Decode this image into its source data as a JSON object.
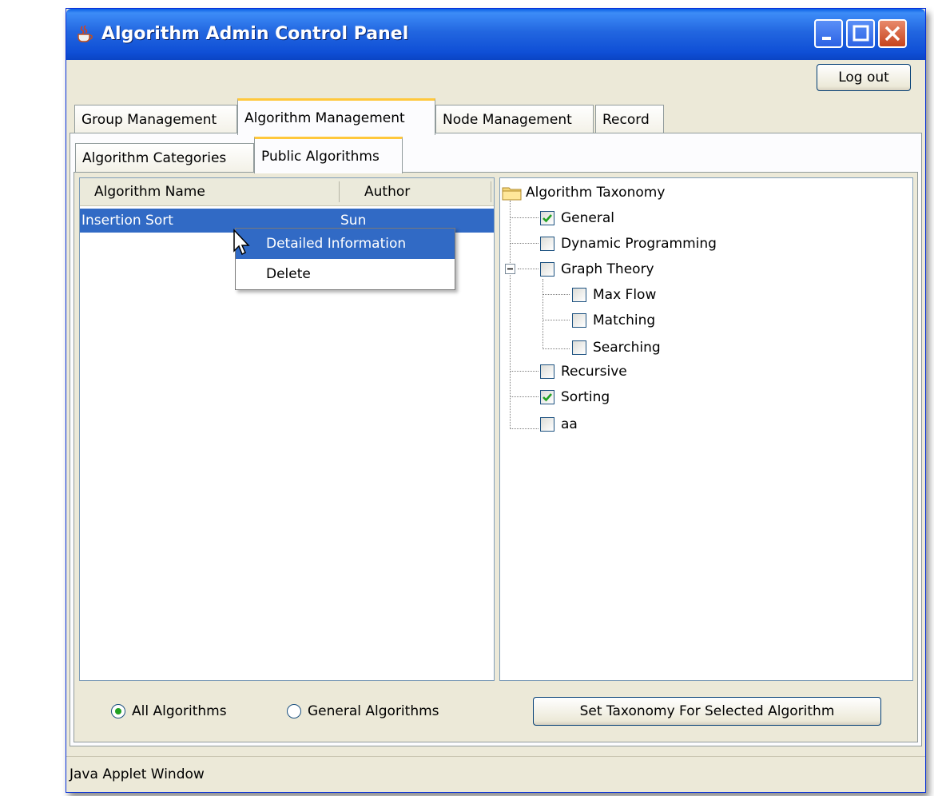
{
  "window": {
    "title": "Algorithm Admin Control Panel"
  },
  "menubar": {
    "logout_label": "Log out"
  },
  "main_tabs": [
    {
      "label": "Group Management"
    },
    {
      "label": "Algorithm Management"
    },
    {
      "label": "Node Management"
    },
    {
      "label": "Record"
    }
  ],
  "sub_tabs": [
    {
      "label": "Algorithm Categories"
    },
    {
      "label": "Public Algorithms"
    }
  ],
  "table": {
    "columns": [
      "Algorithm Name",
      "Author"
    ],
    "rows": [
      {
        "name": "Insertion Sort",
        "author": "Sun"
      }
    ]
  },
  "context_menu": {
    "items": [
      {
        "label": "Detailed Information"
      },
      {
        "label": "Delete"
      }
    ]
  },
  "tree": {
    "root": "Algorithm Taxonomy",
    "nodes": [
      {
        "label": "General",
        "checked": true
      },
      {
        "label": "Dynamic Programming",
        "checked": false
      },
      {
        "label": "Graph Theory",
        "checked": false,
        "expanded": true
      },
      {
        "label": "Max Flow",
        "checked": false
      },
      {
        "label": "Matching",
        "checked": false
      },
      {
        "label": "Searching",
        "checked": false
      },
      {
        "label": "Recursive",
        "checked": false
      },
      {
        "label": "Sorting",
        "checked": true
      },
      {
        "label": "aa",
        "checked": false
      }
    ]
  },
  "filters": {
    "all_label": "All Algorithms",
    "general_label": "General Algorithms",
    "selected": "All Algorithms"
  },
  "actions": {
    "set_taxonomy_label": "Set Taxonomy For Selected Algorithm"
  },
  "status": {
    "text": "Java Applet Window"
  },
  "colors": {
    "selection": "#316ac5",
    "titlebar": "#0a5fe3",
    "checkmark": "#21a121"
  }
}
